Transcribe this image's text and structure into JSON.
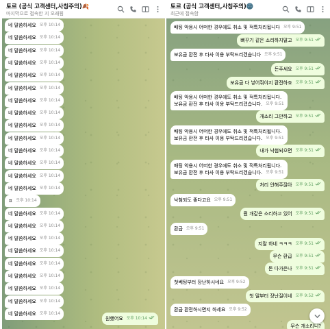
{
  "colors": {
    "outgoing_bubble": "#effdde",
    "incoming_bubble": "#ffffff",
    "time_out": "#5fa061",
    "time_in": "#8a8a8a"
  },
  "icons": [
    "search-icon",
    "phone-icon",
    "columns-icon",
    "more-icon",
    "check-icon",
    "chevron-down-icon"
  ],
  "left": {
    "header": {
      "title": "토르 (공식 고객센터,사칭주의)🍂",
      "subtitle": "마지막으로 접속한 지 오래됨"
    },
    "messages": [
      {
        "text": "네 말씀하세요",
        "time": "오후 10:14"
      },
      {
        "text": "네 말씀하세요",
        "time": "오후 10:14"
      },
      {
        "text": "네 말씀하세요",
        "time": "오후 10:14"
      },
      {
        "text": "네 말씀하세요",
        "time": "오후 10:14"
      },
      {
        "text": "네 말씀하세요",
        "time": "오후 10:14"
      },
      {
        "text": "네 말씀하세요",
        "time": "오후 10:14"
      },
      {
        "text": "네 말씀하세요",
        "time": "오후 10:14"
      },
      {
        "text": "네 말씀하세요",
        "time": "오후 10:14"
      },
      {
        "text": "네 말씀하세요",
        "time": "오후 10:14"
      },
      {
        "text": "네 말씀하세요",
        "time": "오후 10:14"
      },
      {
        "text": "네 말씀하세요",
        "time": "오후 10:14"
      },
      {
        "text": "네 말씀하세요",
        "time": "오후 10:14"
      },
      {
        "text": "네 말씀하세요",
        "time": "오후 10:14"
      },
      {
        "text": "네 말씀하세요",
        "time": "오후 10:14"
      },
      {
        "text": "ㅍ",
        "time": "오후 10:14"
      },
      {
        "text": "네 말씀하세요",
        "time": "오후 10:14"
      },
      {
        "text": "네 말씀하세요",
        "time": "오후 10:14"
      },
      {
        "text": "네 말씀하세요",
        "time": "오후 10:14"
      },
      {
        "text": "네 말씀하세요",
        "time": "오후 10:14"
      },
      {
        "text": "네 말씀하세요",
        "time": "오후 10:14"
      },
      {
        "text": "네 말씀하세요",
        "time": "오후 10:14"
      },
      {
        "text": "네 말씀하세요",
        "time": "오후 10:14"
      },
      {
        "text": "네 말씀하세요",
        "time": "오후 10:14"
      },
      {
        "text": "네 말씀하세요",
        "time": "오후 10:14"
      }
    ],
    "reply": {
      "text": "원했어요",
      "time": "오후 10:14"
    }
  },
  "right": {
    "header": {
      "title": "토르 (공식 고객센터,사칭주의)🌚",
      "subtitle": "최근에 접속함"
    },
    "messages": [
      {
        "side": "in",
        "lines": [
          "배팅 악용시 어떠한 경우에도 취소 및 적특처리됩니다"
        ],
        "time": "오후 9:51"
      },
      {
        "side": "out",
        "lines": [
          "뻐꾸기 같은 소리하지말고"
        ],
        "time": "오후 9:51"
      },
      {
        "side": "in",
        "lines": [
          "보유금 환전 후 타사 이용 부탁드리겠습니다"
        ],
        "time": "오후 9:51"
      },
      {
        "side": "out",
        "lines": [
          "돈주세요"
        ],
        "time": "오후 9:51"
      },
      {
        "side": "out",
        "lines": [
          "보유금 다 넣어줘야지 환전하죠"
        ],
        "time": "오후 9:51"
      },
      {
        "side": "in",
        "lines": [
          "배팅 악용시 어떠한 경우에도 취소 및 적특처리됩니다.",
          "보유금 환전 후 타사 이용 부탁드리겠습니다."
        ],
        "time": "오후 9:51"
      },
      {
        "side": "out",
        "lines": [
          "개소리 그만하고"
        ],
        "time": "오후 9:51"
      },
      {
        "side": "in",
        "lines": [
          "배팅 악용시 어떠한 경우에도 취소 및 적특처리됩니다.",
          "보유금 환전 후 타사 이용 부탁드리겠습니다."
        ],
        "time": "오후 9:51"
      },
      {
        "side": "out",
        "lines": [
          "내가 낙첨되으면"
        ],
        "time": "오후 9:51"
      },
      {
        "side": "in",
        "lines": [
          "배팅 악용시 어떠한 경우에도 취소 및 적특처리됩니다.",
          "보유금 환전 후 타사 이용 부탁드리겠습니다."
        ],
        "time": "오후 9:51"
      },
      {
        "side": "out",
        "lines": [
          "처리 안해주잖아"
        ],
        "time": "오후 9:51"
      },
      {
        "side": "in",
        "lines": [
          "낙첨되도 좋다고요"
        ],
        "time": "오후 9:51"
      },
      {
        "side": "out",
        "lines": [
          "뭔 개같은 소리하고 있어"
        ],
        "time": "오후 9:51"
      },
      {
        "side": "in",
        "lines": [
          "환급"
        ],
        "time": "오후 9:51"
      },
      {
        "side": "out",
        "lines": [
          "지랄 하네 ㅋㅋㅋ"
        ],
        "time": "오후 9:51"
      },
      {
        "side": "out",
        "lines": [
          "무슨 환급"
        ],
        "time": "오후 9:51"
      },
      {
        "side": "out",
        "lines": [
          "돈 다가은나"
        ],
        "time": "오후 9:51"
      },
      {
        "side": "in",
        "lines": [
          "첫베팅부터 장난하시네요"
        ],
        "time": "오후 9:52"
      },
      {
        "side": "out",
        "lines": [
          "첫 말부터 장난질이네"
        ],
        "time": "오후 9:52"
      },
      {
        "side": "in",
        "lines": [
          "환급 환전하시면지 하세요"
        ],
        "time": "오후 9:52"
      },
      {
        "side": "out",
        "lines": [
          "무슨 개소리니?"
        ],
        "time": ""
      }
    ]
  }
}
